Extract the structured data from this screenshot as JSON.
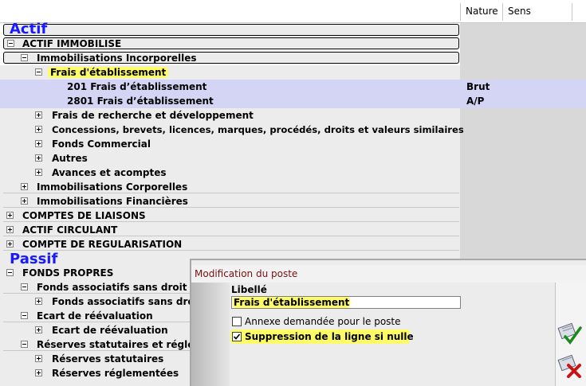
{
  "header": {
    "col_nature": "Nature",
    "col_sens": "Sens"
  },
  "sections": {
    "actif": "Actif",
    "passif": "Passif"
  },
  "tree": {
    "actif_immobilise": "ACTIF IMMOBILISE",
    "immo_incorporelles": "Immobilisations Incorporelles",
    "frais_etablissement": "Frais d'établissement",
    "acc_201": "201 Frais d’établissement",
    "acc_201_nature": "Brut",
    "acc_2801": "2801 Frais d’établissement",
    "acc_2801_nature": "A/P",
    "frais_recherche": "Frais de recherche et développement",
    "concessions": "Concessions, brevets, licences, marques, procédés, droits et valeurs similaires",
    "fonds_commercial": "Fonds Commercial",
    "autres": "Autres",
    "avances": "Avances et acomptes",
    "immo_corporelles": "Immobilisations Corporelles",
    "immo_financieres": "Immobilisations Financières",
    "comptes_liaisons": "COMPTES DE LIAISONS",
    "actif_circulant": "ACTIF CIRCULANT",
    "compte_regularisation": "COMPTE DE REGULARISATION",
    "fonds_propres": "FONDS PROPRES",
    "fonds_assoc_1": "Fonds associatifs sans droit d",
    "fonds_assoc_2": "Fonds associatifs sans droi",
    "ecart_1": "Ecart de réévaluation",
    "ecart_2": "Ecart de réévaluation",
    "reserves": "Réserves statutaires et régle",
    "reserves_statutaires": "Réserves statutaires",
    "reserves_reglementees": "Réserves réglementées"
  },
  "dialog": {
    "title": "Modification du poste",
    "libelle_label": "Libellé",
    "libelle_value": "Frais d'établissement",
    "annexe_label": "Annexe demandée pour le poste",
    "annexe_checked": false,
    "suppression_label": "Suppression de la ligne si nulle",
    "suppression_checked": true,
    "validate_icon": "validate-check-icon",
    "cancel_icon": "cancel-x-icon"
  },
  "colors": {
    "section_blue": "#1a1aff",
    "highlight": "#fdfb66",
    "selected_row": "#d4d4f4",
    "dialog_title": "#7a1010"
  }
}
